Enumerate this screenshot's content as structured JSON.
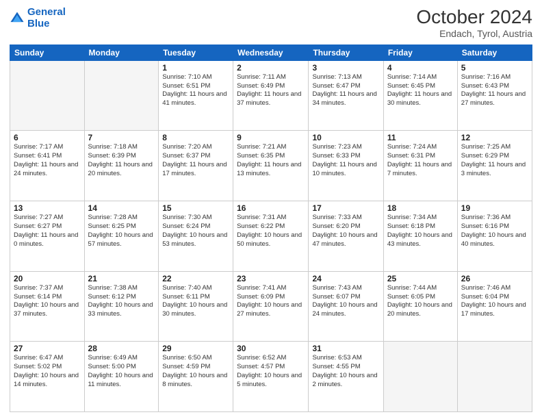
{
  "header": {
    "logo_line1": "General",
    "logo_line2": "Blue",
    "title": "October 2024",
    "subtitle": "Endach, Tyrol, Austria"
  },
  "weekdays": [
    "Sunday",
    "Monday",
    "Tuesday",
    "Wednesday",
    "Thursday",
    "Friday",
    "Saturday"
  ],
  "weeks": [
    [
      {
        "day": "",
        "sunrise": "",
        "sunset": "",
        "daylight": ""
      },
      {
        "day": "",
        "sunrise": "",
        "sunset": "",
        "daylight": ""
      },
      {
        "day": "1",
        "sunrise": "Sunrise: 7:10 AM",
        "sunset": "Sunset: 6:51 PM",
        "daylight": "Daylight: 11 hours and 41 minutes."
      },
      {
        "day": "2",
        "sunrise": "Sunrise: 7:11 AM",
        "sunset": "Sunset: 6:49 PM",
        "daylight": "Daylight: 11 hours and 37 minutes."
      },
      {
        "day": "3",
        "sunrise": "Sunrise: 7:13 AM",
        "sunset": "Sunset: 6:47 PM",
        "daylight": "Daylight: 11 hours and 34 minutes."
      },
      {
        "day": "4",
        "sunrise": "Sunrise: 7:14 AM",
        "sunset": "Sunset: 6:45 PM",
        "daylight": "Daylight: 11 hours and 30 minutes."
      },
      {
        "day": "5",
        "sunrise": "Sunrise: 7:16 AM",
        "sunset": "Sunset: 6:43 PM",
        "daylight": "Daylight: 11 hours and 27 minutes."
      }
    ],
    [
      {
        "day": "6",
        "sunrise": "Sunrise: 7:17 AM",
        "sunset": "Sunset: 6:41 PM",
        "daylight": "Daylight: 11 hours and 24 minutes."
      },
      {
        "day": "7",
        "sunrise": "Sunrise: 7:18 AM",
        "sunset": "Sunset: 6:39 PM",
        "daylight": "Daylight: 11 hours and 20 minutes."
      },
      {
        "day": "8",
        "sunrise": "Sunrise: 7:20 AM",
        "sunset": "Sunset: 6:37 PM",
        "daylight": "Daylight: 11 hours and 17 minutes."
      },
      {
        "day": "9",
        "sunrise": "Sunrise: 7:21 AM",
        "sunset": "Sunset: 6:35 PM",
        "daylight": "Daylight: 11 hours and 13 minutes."
      },
      {
        "day": "10",
        "sunrise": "Sunrise: 7:23 AM",
        "sunset": "Sunset: 6:33 PM",
        "daylight": "Daylight: 11 hours and 10 minutes."
      },
      {
        "day": "11",
        "sunrise": "Sunrise: 7:24 AM",
        "sunset": "Sunset: 6:31 PM",
        "daylight": "Daylight: 11 hours and 7 minutes."
      },
      {
        "day": "12",
        "sunrise": "Sunrise: 7:25 AM",
        "sunset": "Sunset: 6:29 PM",
        "daylight": "Daylight: 11 hours and 3 minutes."
      }
    ],
    [
      {
        "day": "13",
        "sunrise": "Sunrise: 7:27 AM",
        "sunset": "Sunset: 6:27 PM",
        "daylight": "Daylight: 11 hours and 0 minutes."
      },
      {
        "day": "14",
        "sunrise": "Sunrise: 7:28 AM",
        "sunset": "Sunset: 6:25 PM",
        "daylight": "Daylight: 10 hours and 57 minutes."
      },
      {
        "day": "15",
        "sunrise": "Sunrise: 7:30 AM",
        "sunset": "Sunset: 6:24 PM",
        "daylight": "Daylight: 10 hours and 53 minutes."
      },
      {
        "day": "16",
        "sunrise": "Sunrise: 7:31 AM",
        "sunset": "Sunset: 6:22 PM",
        "daylight": "Daylight: 10 hours and 50 minutes."
      },
      {
        "day": "17",
        "sunrise": "Sunrise: 7:33 AM",
        "sunset": "Sunset: 6:20 PM",
        "daylight": "Daylight: 10 hours and 47 minutes."
      },
      {
        "day": "18",
        "sunrise": "Sunrise: 7:34 AM",
        "sunset": "Sunset: 6:18 PM",
        "daylight": "Daylight: 10 hours and 43 minutes."
      },
      {
        "day": "19",
        "sunrise": "Sunrise: 7:36 AM",
        "sunset": "Sunset: 6:16 PM",
        "daylight": "Daylight: 10 hours and 40 minutes."
      }
    ],
    [
      {
        "day": "20",
        "sunrise": "Sunrise: 7:37 AM",
        "sunset": "Sunset: 6:14 PM",
        "daylight": "Daylight: 10 hours and 37 minutes."
      },
      {
        "day": "21",
        "sunrise": "Sunrise: 7:38 AM",
        "sunset": "Sunset: 6:12 PM",
        "daylight": "Daylight: 10 hours and 33 minutes."
      },
      {
        "day": "22",
        "sunrise": "Sunrise: 7:40 AM",
        "sunset": "Sunset: 6:11 PM",
        "daylight": "Daylight: 10 hours and 30 minutes."
      },
      {
        "day": "23",
        "sunrise": "Sunrise: 7:41 AM",
        "sunset": "Sunset: 6:09 PM",
        "daylight": "Daylight: 10 hours and 27 minutes."
      },
      {
        "day": "24",
        "sunrise": "Sunrise: 7:43 AM",
        "sunset": "Sunset: 6:07 PM",
        "daylight": "Daylight: 10 hours and 24 minutes."
      },
      {
        "day": "25",
        "sunrise": "Sunrise: 7:44 AM",
        "sunset": "Sunset: 6:05 PM",
        "daylight": "Daylight: 10 hours and 20 minutes."
      },
      {
        "day": "26",
        "sunrise": "Sunrise: 7:46 AM",
        "sunset": "Sunset: 6:04 PM",
        "daylight": "Daylight: 10 hours and 17 minutes."
      }
    ],
    [
      {
        "day": "27",
        "sunrise": "Sunrise: 6:47 AM",
        "sunset": "Sunset: 5:02 PM",
        "daylight": "Daylight: 10 hours and 14 minutes."
      },
      {
        "day": "28",
        "sunrise": "Sunrise: 6:49 AM",
        "sunset": "Sunset: 5:00 PM",
        "daylight": "Daylight: 10 hours and 11 minutes."
      },
      {
        "day": "29",
        "sunrise": "Sunrise: 6:50 AM",
        "sunset": "Sunset: 4:59 PM",
        "daylight": "Daylight: 10 hours and 8 minutes."
      },
      {
        "day": "30",
        "sunrise": "Sunrise: 6:52 AM",
        "sunset": "Sunset: 4:57 PM",
        "daylight": "Daylight: 10 hours and 5 minutes."
      },
      {
        "day": "31",
        "sunrise": "Sunrise: 6:53 AM",
        "sunset": "Sunset: 4:55 PM",
        "daylight": "Daylight: 10 hours and 2 minutes."
      },
      {
        "day": "",
        "sunrise": "",
        "sunset": "",
        "daylight": ""
      },
      {
        "day": "",
        "sunrise": "",
        "sunset": "",
        "daylight": ""
      }
    ]
  ]
}
